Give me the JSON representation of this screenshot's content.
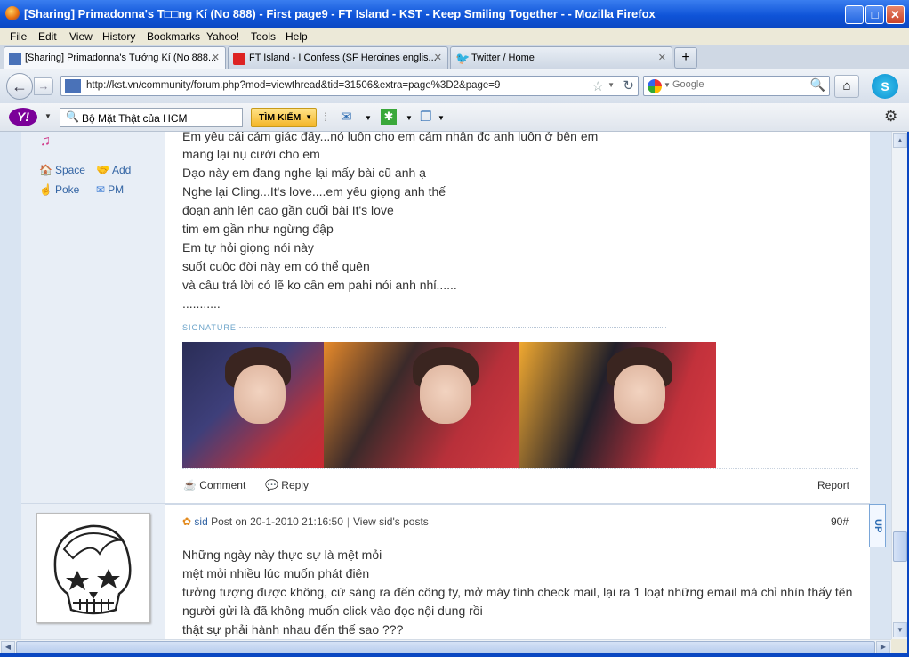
{
  "window": {
    "title": "[Sharing] Primadonna's T□□ng Kí (No 888) - First page9 - FT Island - KST - Keep Smiling Together - - Mozilla Firefox"
  },
  "menu": [
    "File",
    "Edit",
    "View",
    "History",
    "Bookmarks",
    "Yahoo!",
    "Tools",
    "Help"
  ],
  "tabs": [
    {
      "label": "[Sharing] Primadonna's Tướng Kí (No 888...",
      "active": true
    },
    {
      "label": "FT Island - I Confess (SF Heroines englis...",
      "active": false
    },
    {
      "label": "Twitter / Home",
      "active": false
    }
  ],
  "nav": {
    "url": "http://kst.vn/community/forum.php?mod=viewthread&tid=31506&extra=page%3D2&page=9",
    "search_placeholder": "Google"
  },
  "yahoo": {
    "logo": "Y!",
    "search_value": "Bộ Mặt Thật của HCM",
    "search_button": "TÌM KIẾM"
  },
  "post1": {
    "side_links": {
      "space": "Space",
      "add": "Add",
      "poke": "Poke",
      "pm": "PM"
    },
    "lines": [
      "Em yêu cái cảm giác đấy...nó luôn cho em cảm nhận đc anh luôn ở bên em",
      "mang lại nụ cười cho em",
      "Dạo này em đang nghe lại mấy bài cũ anh ạ",
      "Nghe lại Cling...It's love....em yêu giọng anh thế",
      "đoạn anh lên cao gần cuối bài It's love",
      "tim em gần như ngừng đập",
      "Em tự hỏi giọng nói này",
      "suốt cuộc đời này em có thể quên",
      "và câu trả lời có lẽ ko cần em pahi nói anh nhỉ......",
      "..........."
    ],
    "signature_label": "SIGNATURE",
    "actions": {
      "comment": "Comment",
      "reply": "Reply",
      "report": "Report"
    }
  },
  "post2": {
    "author": "sid",
    "posted": "Post on 20-1-2010 21:16:50",
    "view_posts": "View sid's posts",
    "floor": "90#",
    "lines": [
      "Những ngày này thực sự là mệt mỏi",
      "mệt mỏi nhiều lúc muốn phát điên",
      "tưởng tượng được không, cứ sáng ra đến công ty, mở máy tính check mail, lại ra 1 loạt những email mà chỉ nhìn thấy tên",
      "người gửi là đã không muốn click vào đọc nội dung rồi",
      "thật sự phải hành nhau đến thế sao ???"
    ]
  },
  "up_button": "UP"
}
